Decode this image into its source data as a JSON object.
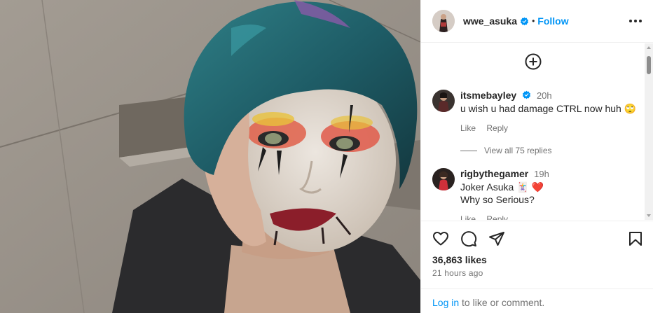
{
  "post": {
    "username": "wwe_asuka",
    "dot": "•",
    "follow_label": "Follow",
    "more_icon": "more-horizontal-icon",
    "verified_color": "#0095f6"
  },
  "comments": [
    {
      "username": "itsmebayley",
      "verified": true,
      "time": "20h",
      "lines": [
        "u wish u had damage CTRL now huh 🙄"
      ],
      "like_label": "Like",
      "reply_label": "Reply"
    },
    {
      "username": "rigbythegamer",
      "verified": false,
      "time": "19h",
      "lines": [
        "Joker Asuka 🃏 ❤️",
        "Why so Serious?"
      ],
      "like_label": "Like",
      "reply_label": "Reply"
    }
  ],
  "view_replies": "View all 75 replies",
  "actions": {
    "icons": [
      "heart-icon",
      "comment-icon",
      "share-icon",
      "bookmark-icon"
    ]
  },
  "likes_text": "36,863 likes",
  "time_ago": "21 hours ago",
  "footer": {
    "login_label": "Log in",
    "rest": " to like or comment."
  },
  "colors": {
    "accent": "#0095f6",
    "text": "#262626",
    "muted": "#737373",
    "divider": "#efefef"
  }
}
